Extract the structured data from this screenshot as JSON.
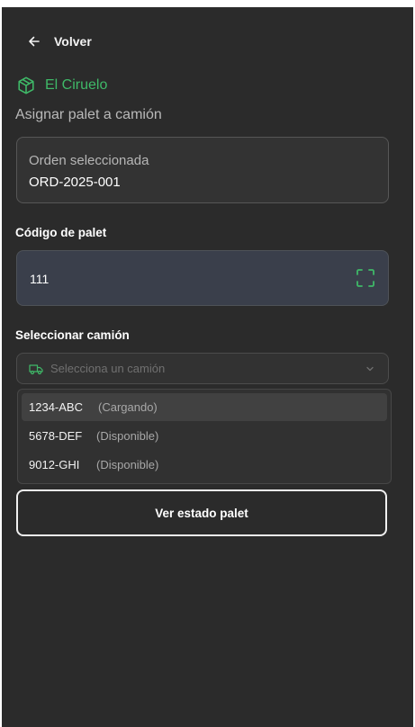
{
  "nav": {
    "back_label": "Volver"
  },
  "brand": {
    "name": "El Ciruelo"
  },
  "page": {
    "subtitle": "Asignar palet a camión"
  },
  "order": {
    "label": "Orden seleccionada",
    "value": "ORD-2025-001"
  },
  "pallet": {
    "label": "Código de palet",
    "value": "111"
  },
  "truck": {
    "label": "Seleccionar camión",
    "placeholder": "Selecciona un camión",
    "options": [
      {
        "plate": "1234-ABC",
        "status": "(Cargando)"
      },
      {
        "plate": "5678-DEF",
        "status": "(Disponible)"
      },
      {
        "plate": "9012-GHI",
        "status": "(Disponible)"
      }
    ]
  },
  "actions": {
    "view_state": "Ver estado palet"
  },
  "colors": {
    "accent": "#3fb968",
    "background": "#2b2b2b",
    "input_bg": "#3a3f4b"
  }
}
